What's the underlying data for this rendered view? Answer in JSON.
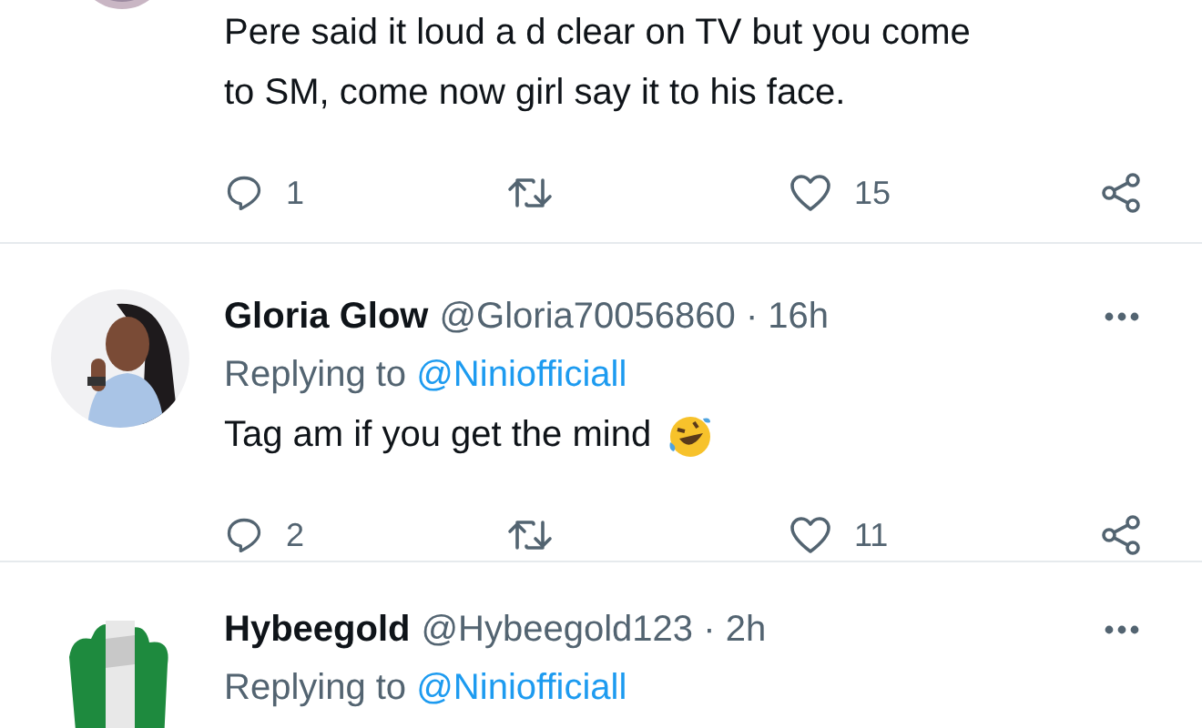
{
  "tweets": [
    {
      "kind": "cut",
      "text": "Pere said it loud a d clear on TV but you come to SM, come now girl say it to his face.",
      "replies": "1",
      "likes": "15"
    },
    {
      "kind": "full",
      "name": "Gloria Glow",
      "meta": "@Gloria70056860 · 16h",
      "replying": "Replying to",
      "reply_handle": "@Niniofficiall",
      "text": "Tag am if you get the mind",
      "emoji": true,
      "replies": "2",
      "likes": "11"
    },
    {
      "kind": "full",
      "name": "Hybeegold",
      "meta": "@Hybeegold123 · 2h",
      "replying": "Replying to",
      "reply_handle": "@Niniofficiall"
    }
  ]
}
